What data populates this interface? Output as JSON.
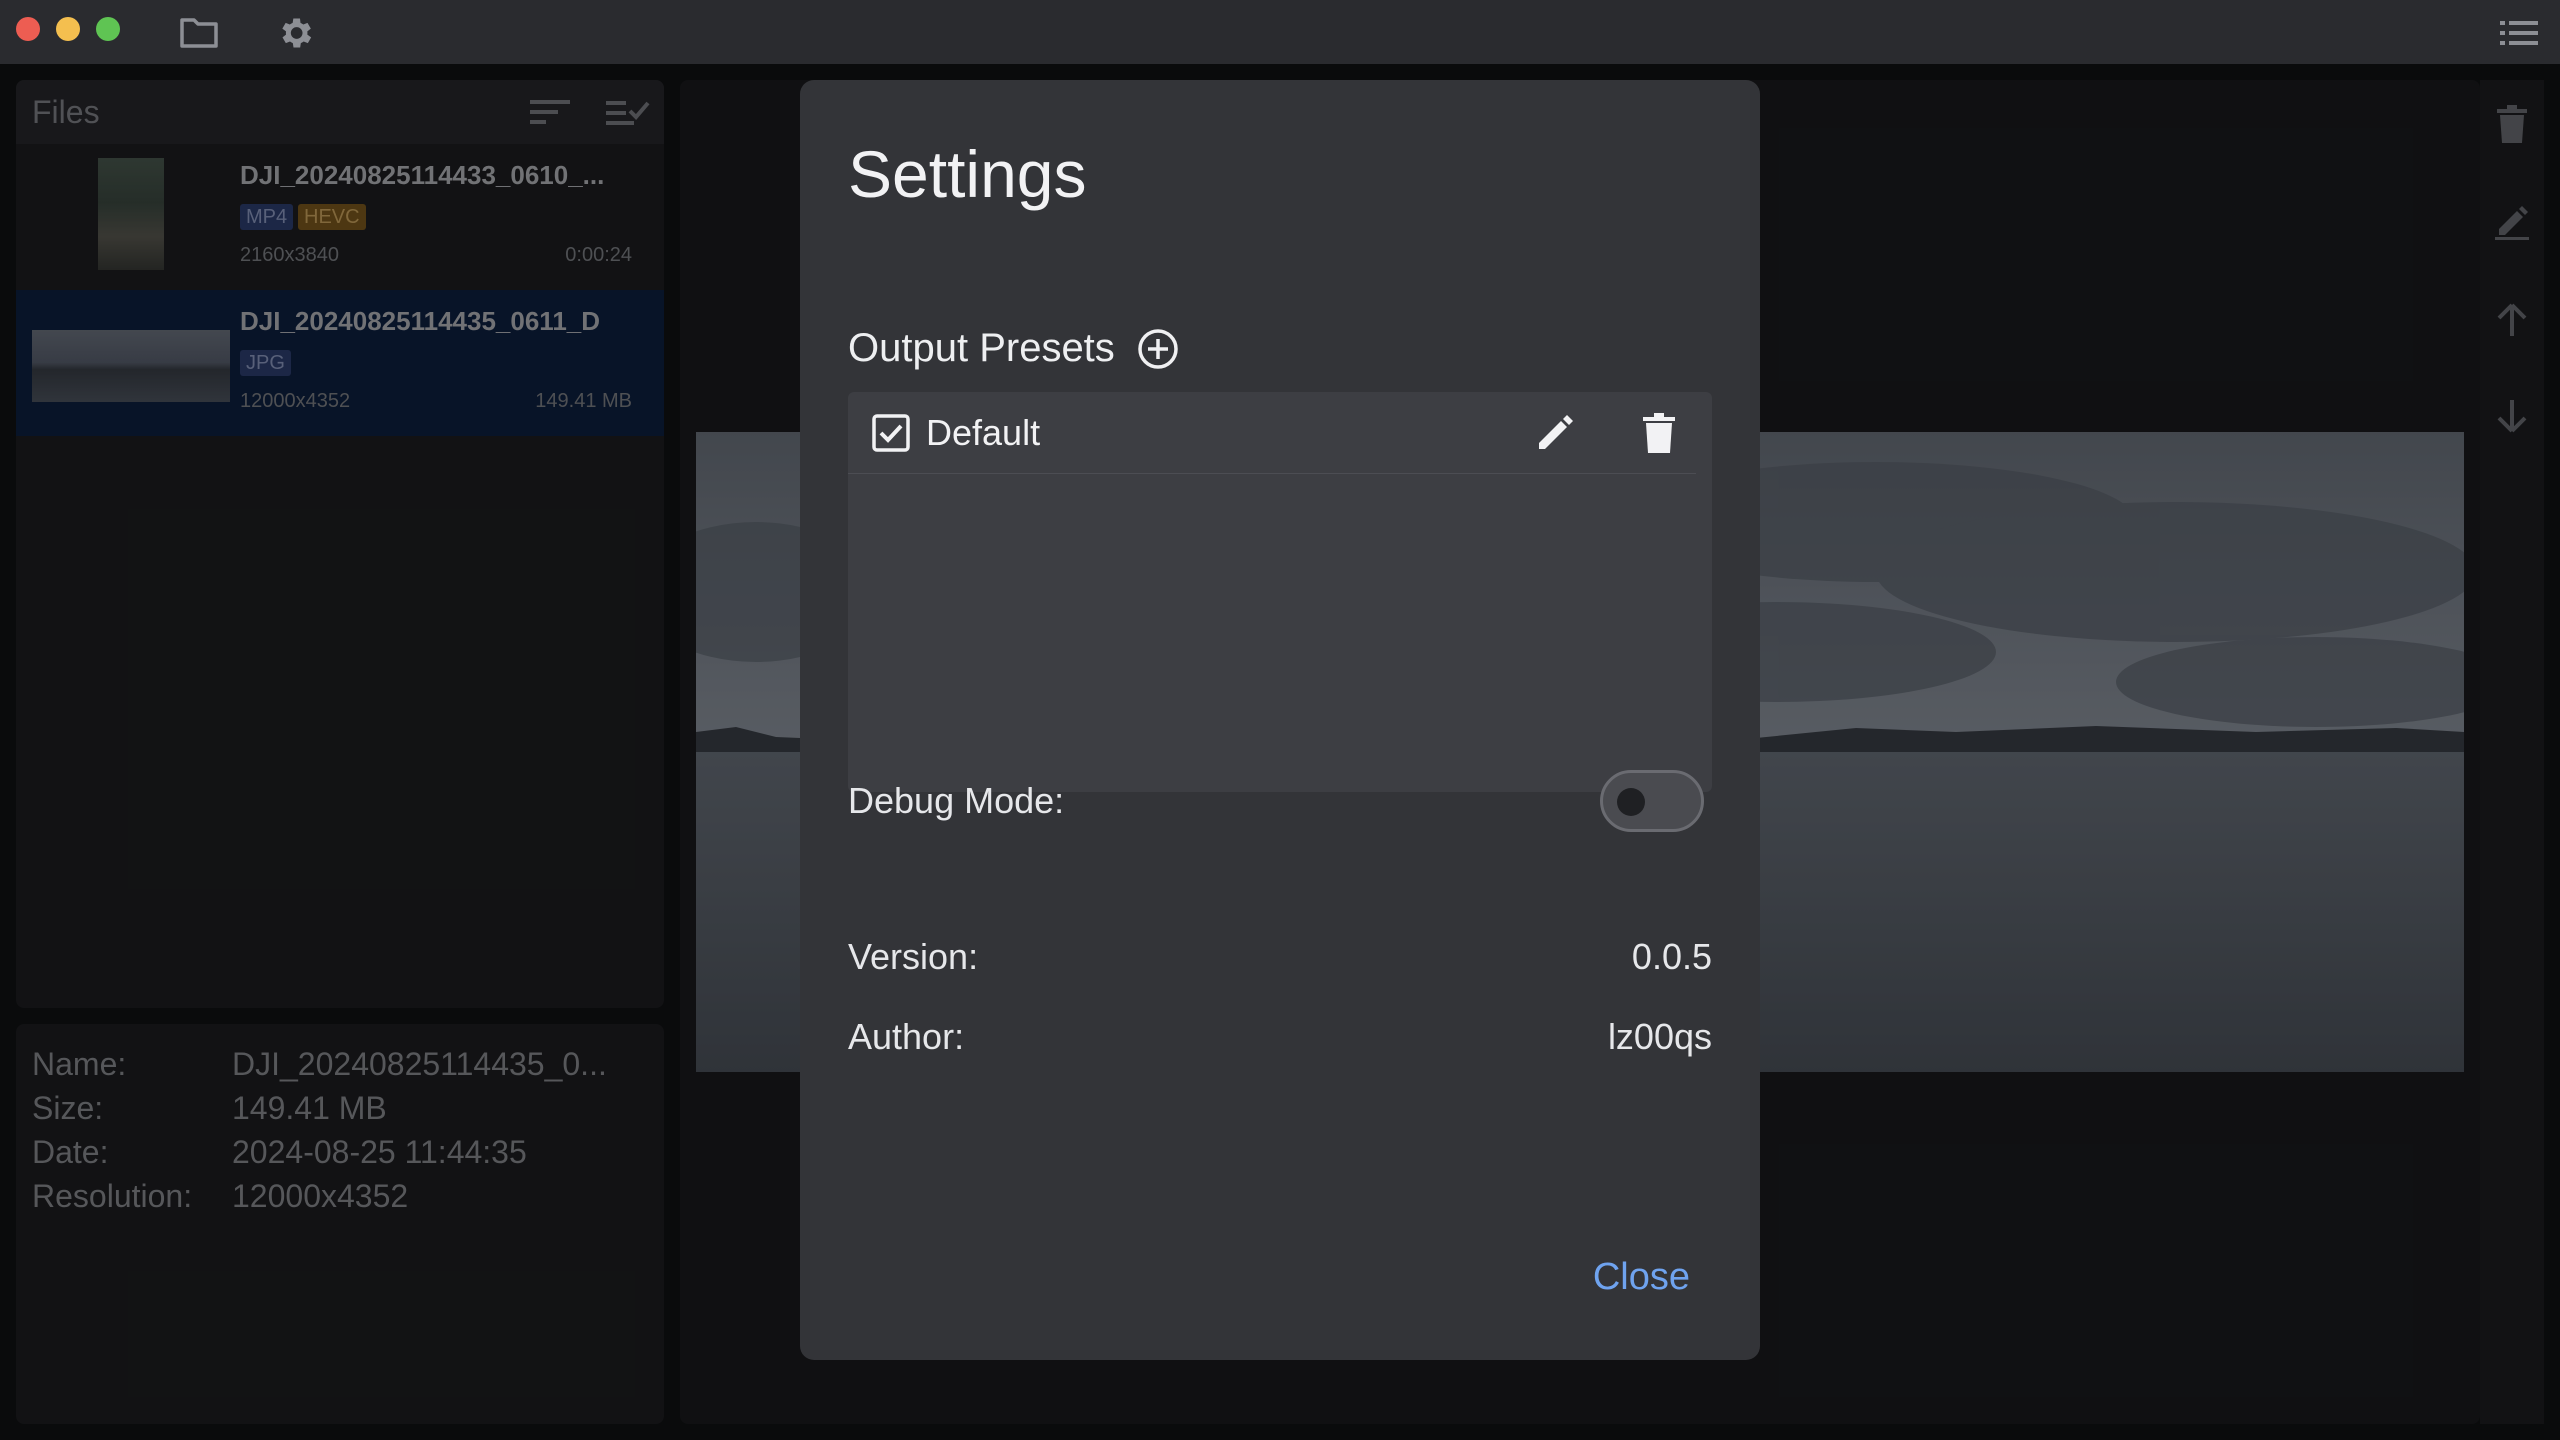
{
  "files_panel": {
    "title": "Files",
    "items": [
      {
        "name": "DJI_20240825114433_0610_...",
        "badges": [
          "MP4",
          "HEVC"
        ],
        "resolution": "2160x3840",
        "extra": "0:00:24"
      },
      {
        "name": "DJI_20240825114435_0611_D",
        "badges": [
          "JPG"
        ],
        "resolution": "12000x4352",
        "extra": "149.41 MB"
      }
    ]
  },
  "info": {
    "name_label": "Name:",
    "name_value": "DJI_20240825114435_0...",
    "size_label": "Size:",
    "size_value": "149.41 MB",
    "date_label": "Date:",
    "date_value": "2024-08-25 11:44:35",
    "resolution_label": "Resolution:",
    "resolution_value": "12000x4352"
  },
  "settings": {
    "title": "Settings",
    "output_presets_label": "Output Presets",
    "presets": [
      {
        "label": "Default",
        "checked": true
      }
    ],
    "debug_mode_label": "Debug Mode:",
    "debug_mode_on": false,
    "version_label": "Version:",
    "version_value": "0.0.5",
    "author_label": "Author:",
    "author_value": "lz00qs",
    "close_label": "Close"
  },
  "icons": {
    "titlebar": [
      "folder-icon",
      "gear-icon",
      "list-icon"
    ],
    "files_header": [
      "sort-icon",
      "select-all-icon"
    ],
    "side_tools": [
      "trash-icon",
      "edit-icon",
      "arrow-up-icon",
      "arrow-down-icon"
    ]
  },
  "colors": {
    "accent": "#6fa3ef",
    "selected_item": "#0e2142",
    "modal_bg": "#333438"
  }
}
